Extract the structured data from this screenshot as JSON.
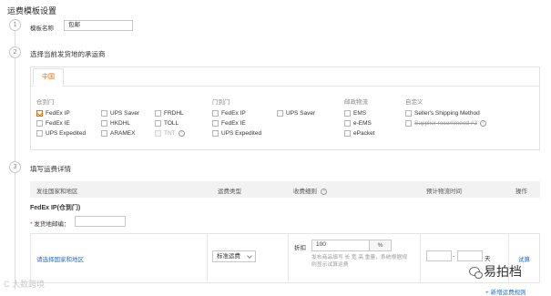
{
  "page": {
    "title": "运费模板设置"
  },
  "steps": [
    {
      "num": "1",
      "title": ""
    },
    {
      "num": "2",
      "title": "选择当前发货地的承运商"
    },
    {
      "num": "3",
      "title": "填写运费详情"
    }
  ],
  "template_name": {
    "label": "模板名称",
    "value": "包邮"
  },
  "carrier_tab": {
    "label": "中国"
  },
  "groups": {
    "door": {
      "head": "仓到门",
      "col1": [
        {
          "label": "FedEx IP",
          "checked": true
        },
        {
          "label": "FedEx IE",
          "checked": false
        },
        {
          "label": "UPS Expedited",
          "checked": false
        }
      ],
      "col2": [
        {
          "label": "UPS Saver",
          "checked": false
        },
        {
          "label": "HKDHL",
          "checked": false
        },
        {
          "label": "ARAMEX",
          "checked": false
        }
      ],
      "col3": [
        {
          "label": "FRDHL",
          "checked": false
        },
        {
          "label": "TOLL",
          "checked": false
        },
        {
          "label": "TNT",
          "checked": false,
          "disabled": true
        }
      ]
    },
    "door2": {
      "head": "门到门",
      "col1": [
        {
          "label": "FedEx IP",
          "checked": false
        },
        {
          "label": "FedEx IE",
          "checked": false
        },
        {
          "label": "UPS Expedited",
          "checked": false
        }
      ],
      "col2": [
        {
          "label": "UPS Saver",
          "checked": false
        }
      ]
    },
    "post": {
      "head": "邮政物流",
      "items": [
        {
          "label": "EMS",
          "checked": false
        },
        {
          "label": "e-EMS",
          "checked": false
        },
        {
          "label": "ePacket",
          "checked": false
        }
      ]
    },
    "custom": {
      "head": "自定义",
      "items": [
        {
          "label": "Seller's Shipping Method",
          "checked": false
        },
        {
          "label": "Supplier recommend #2",
          "checked": false,
          "strike": true
        }
      ]
    }
  },
  "table": {
    "headers": {
      "destination": "发往国家和地区",
      "type": "运费类型",
      "detail": "收费细则",
      "time": "预计物流时间",
      "action": "操作"
    },
    "carrier_title": "FedEx IP(仓到门)",
    "zip_label": "发货地邮编：",
    "row": {
      "region_link": "请选择国家和地区",
      "type_value": "标准运费",
      "discount_label": "折扣",
      "discount_value": "100",
      "discount_unit": "%",
      "hint": "发布商品填写 长 宽 高 重量，系统根据规则显示试算运费",
      "time_sep": "-",
      "time_unit": "天",
      "action_link": "试算"
    },
    "add_rule": "+ 新增运费规则"
  },
  "watermarks": {
    "left": "C 大数跨境",
    "right": "易拍档"
  }
}
